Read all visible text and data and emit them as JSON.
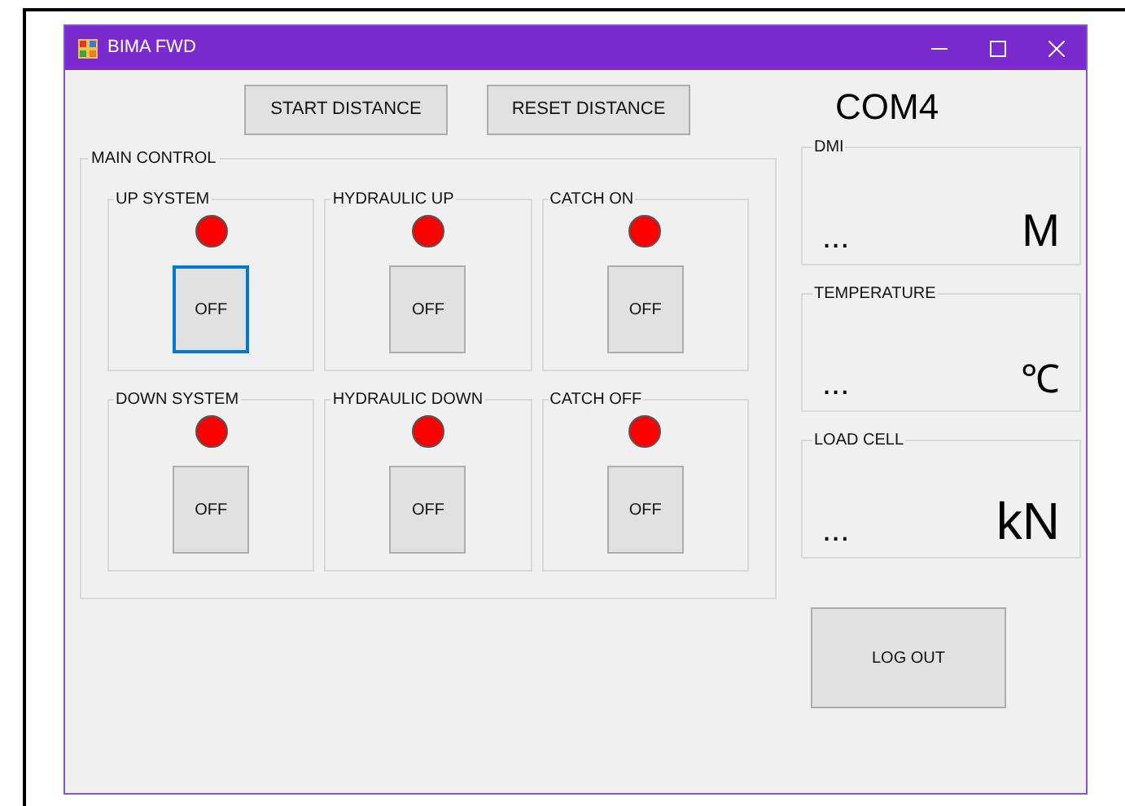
{
  "window": {
    "title": "BIMA FWD"
  },
  "top_buttons": [
    "START DISTANCE",
    "RESET DISTANCE"
  ],
  "port": "COM4",
  "main_control": {
    "title": "MAIN CONTROL",
    "groups": [
      {
        "title": "UP SYSTEM",
        "color": "#ff0000",
        "button": "OFF",
        "focused": true
      },
      {
        "title": "HYDRAULIC UP",
        "color": "#ff0000",
        "button": "OFF",
        "focused": false
      },
      {
        "title": "CATCH ON",
        "color": "#ff0000",
        "button": "OFF",
        "focused": false
      },
      {
        "title": "DOWN SYSTEM",
        "color": "#ff0000",
        "button": "OFF",
        "focused": false
      },
      {
        "title": "HYDRAULIC DOWN",
        "color": "#ff0000",
        "button": "OFF",
        "focused": false
      },
      {
        "title": "CATCH OFF",
        "color": "#ff0000",
        "button": "OFF",
        "focused": false
      }
    ]
  },
  "readings": [
    {
      "title": "DMI",
      "value": "...",
      "unit": "M"
    },
    {
      "title": "TEMPERATURE",
      "value": "...",
      "unit": "℃"
    },
    {
      "title": "LOAD CELL",
      "value": "...",
      "unit": "kN"
    }
  ],
  "logout_button": "LOG OUT"
}
